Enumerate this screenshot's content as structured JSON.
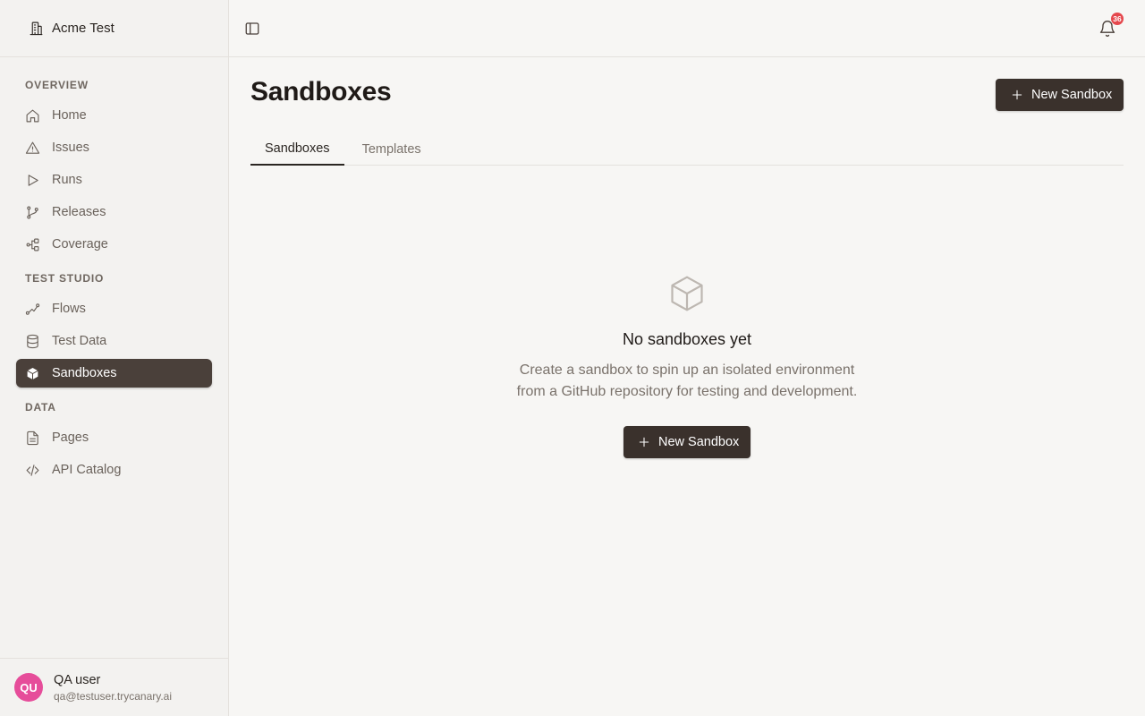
{
  "org": {
    "name": "Acme Test",
    "icon": "building-icon"
  },
  "sidebar": {
    "sections": [
      {
        "label": "OVERVIEW",
        "items": [
          {
            "label": "Home",
            "icon": "home-icon"
          },
          {
            "label": "Issues",
            "icon": "alert-triangle-icon"
          },
          {
            "label": "Runs",
            "icon": "play-icon"
          },
          {
            "label": "Releases",
            "icon": "git-branch-icon"
          },
          {
            "label": "Coverage",
            "icon": "network-icon"
          }
        ]
      },
      {
        "label": "TEST STUDIO",
        "items": [
          {
            "label": "Flows",
            "icon": "route-icon"
          },
          {
            "label": "Test Data",
            "icon": "database-icon"
          },
          {
            "label": "Sandboxes",
            "icon": "box-icon",
            "active": true
          }
        ]
      },
      {
        "label": "DATA",
        "items": [
          {
            "label": "Pages",
            "icon": "file-text-icon"
          },
          {
            "label": "API Catalog",
            "icon": "code-icon"
          }
        ]
      }
    ]
  },
  "user": {
    "initials": "QU",
    "name": "QA user",
    "email": "qa@testuser.trycanary.ai",
    "avatar_color": "#e64d9a"
  },
  "topbar": {
    "notification_count": "36",
    "badge_color": "#e5484d"
  },
  "page": {
    "title": "Sandboxes",
    "new_button_label": "New Sandbox",
    "tabs": [
      {
        "label": "Sandboxes",
        "active": true
      },
      {
        "label": "Templates",
        "active": false
      }
    ]
  },
  "empty_state": {
    "icon": "box-icon",
    "title": "No sandboxes yet",
    "description_line1": "Create a sandbox to spin up an isolated environment",
    "description_line2": "from a GitHub repository for testing and development.",
    "button_label": "New Sandbox"
  },
  "colors": {
    "primary": "#3a312c",
    "active_nav": "#4a403a",
    "background": "#f7f6f4"
  }
}
